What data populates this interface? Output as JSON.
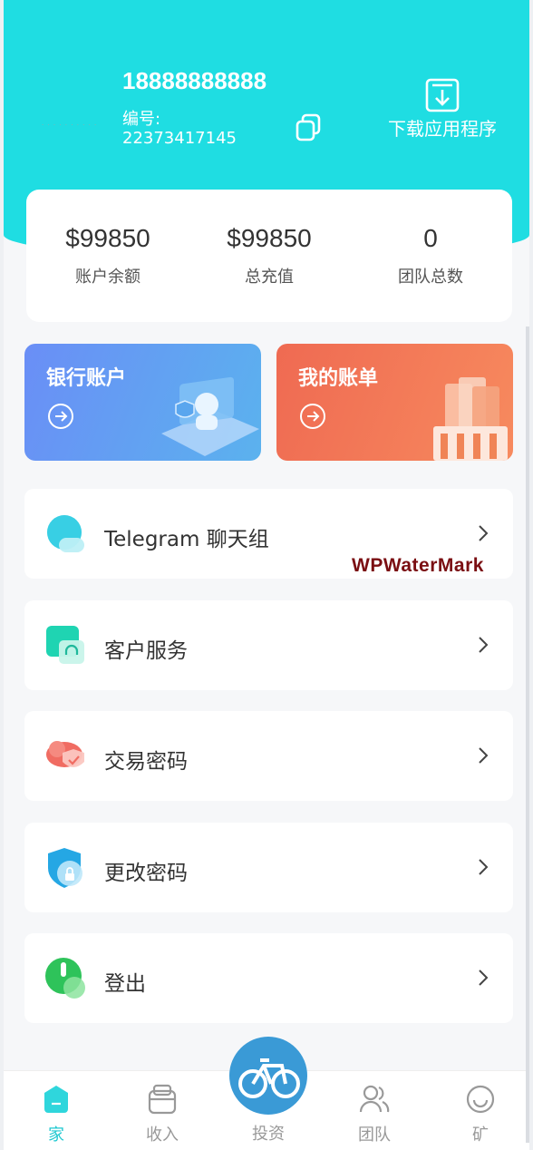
{
  "header": {
    "phone": "18888888888",
    "uid_label": "编号:",
    "uid_value": "22373417145",
    "download_label": "下载应用程序",
    "colors": {
      "accent": "#1fdde2"
    },
    "icons": {
      "copy": "copy-icon",
      "download": "download-icon"
    }
  },
  "stats": [
    {
      "value": "$99850",
      "label": "账户余额"
    },
    {
      "value": "$99850",
      "label": "总充值"
    },
    {
      "value": "0",
      "label": "团队总数"
    }
  ],
  "features": {
    "bank": {
      "title": "银行账户",
      "color": "#6a8ef6"
    },
    "bill": {
      "title": "我的账单",
      "color": "#ef6a52"
    }
  },
  "menu": [
    {
      "label": "Telegram 聊天组",
      "icon": "telegram-chat-icon"
    },
    {
      "label": "客户服务",
      "icon": "customer-service-icon"
    },
    {
      "label": "交易密码",
      "icon": "transaction-password-icon"
    },
    {
      "label": "更改密码",
      "icon": "change-password-icon"
    },
    {
      "label": "登出",
      "icon": "logout-icon"
    }
  ],
  "watermark": "WPWaterMark",
  "tabbar": {
    "home": "家",
    "income": "收入",
    "invest": "投资",
    "team": "团队",
    "mine": "矿",
    "active": "home"
  }
}
